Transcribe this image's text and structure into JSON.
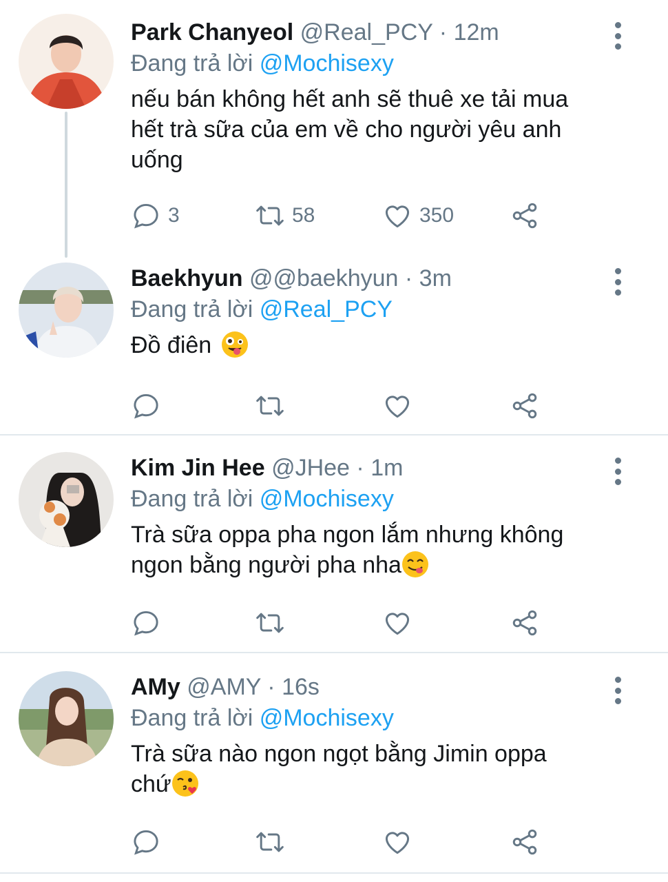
{
  "tweets": [
    {
      "name": "Park Chanyeol",
      "handle": "@Real_PCY",
      "separator": "·",
      "time": "12m",
      "reply_prefix": "Đang trả lời",
      "reply_to": "@Mochisexy",
      "text": "nếu bán không hết anh sẽ thuê xe tải mua\nhết trà sữa của em về cho người yêu anh\nuống",
      "emoji": "",
      "replies": "3",
      "retweets": "58",
      "likes": "350"
    },
    {
      "name": "Baekhyun",
      "handle": "@@baekhyun",
      "separator": "·",
      "time": "3m",
      "reply_prefix": "Đang trả lời",
      "reply_to": "@Real_PCY",
      "text": "Đồ điên ",
      "emoji": "zany-face",
      "replies": "",
      "retweets": "",
      "likes": ""
    },
    {
      "name": "Kim Jin Hee",
      "handle": "@JHee",
      "separator": "·",
      "time": "1m",
      "reply_prefix": "Đang trả lời",
      "reply_to": "@Mochisexy",
      "text": "Trà sữa oppa pha ngon lắm nhưng không\nngon bằng người pha nha",
      "emoji": "yum-face",
      "replies": "",
      "retweets": "",
      "likes": ""
    },
    {
      "name": "AMy",
      "handle": "@AMY",
      "separator": "·",
      "time": "16s",
      "reply_prefix": "Đang trả lời",
      "reply_to": "@Mochisexy",
      "text": "Trà sữa nào ngon ngọt bằng Jimin oppa\nchứ",
      "emoji": "kiss-face",
      "replies": "",
      "retweets": "",
      "likes": ""
    }
  ],
  "icons": {
    "reply": "reply-icon",
    "retweet": "retweet-icon",
    "like": "heart-icon",
    "share": "share-icon",
    "more": "more-vertical-icon"
  },
  "colors": {
    "mention": "#1da1f2",
    "secondary": "#657786",
    "divider": "#e1e8ed"
  }
}
